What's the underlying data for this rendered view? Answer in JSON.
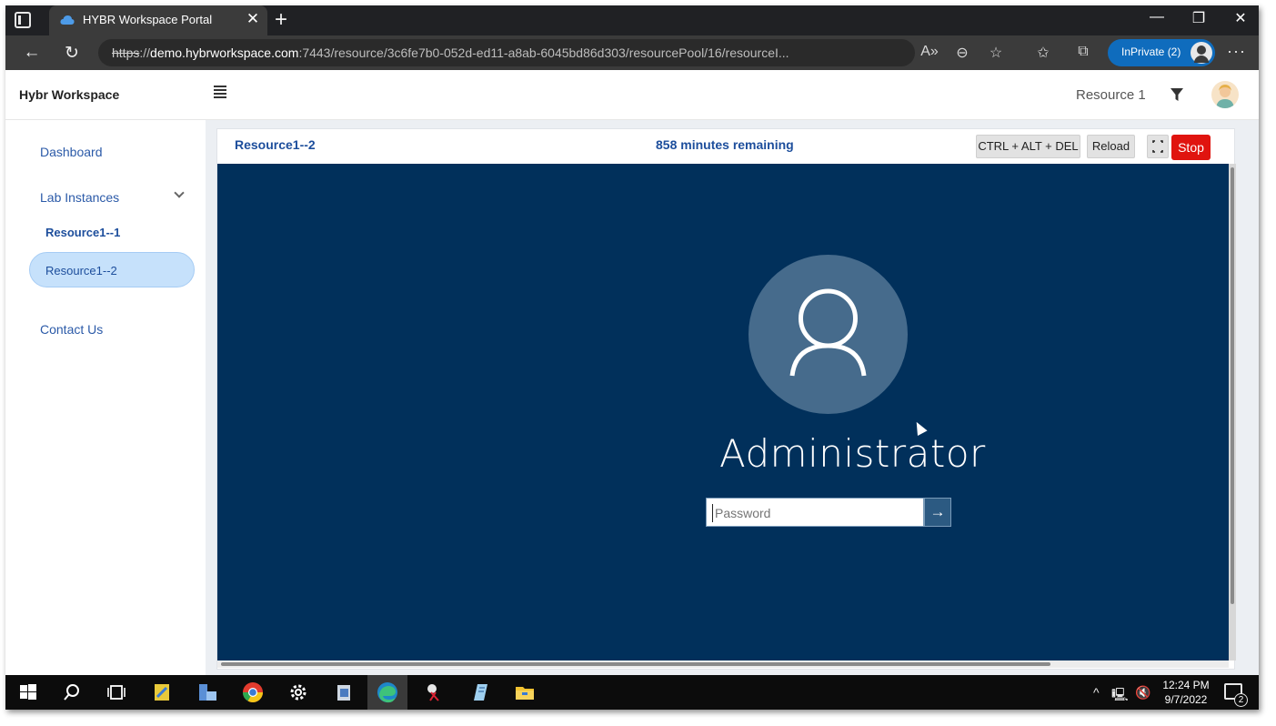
{
  "browser": {
    "tab_title": "HYBR Workspace Portal",
    "tab_close": "✕",
    "new_tab": "+",
    "url_scheme": "https",
    "url_sep": "://",
    "url_host": "demo.hybrworkspace.com",
    "url_rest": ":7443/resource/3c6fe7b0-052d-ed11-a8ab-6045bd86d303/resourcePool/16/resourceI...",
    "inprivate_label": "InPrivate (2)",
    "more": "···",
    "minimize": "—",
    "restore": "❐",
    "close": "✕"
  },
  "header": {
    "brand": "Hybr Workspace",
    "resource_label": "Resource 1"
  },
  "sidebar": {
    "dashboard": "Dashboard",
    "lab_instances": "Lab Instances",
    "resource_1": "Resource1--1",
    "resource_2": "Resource1--2",
    "contact": "Contact Us"
  },
  "resource_panel": {
    "title": "Resource1--2",
    "timer": "858 minutes remaining",
    "ctrl_alt_del": "CTRL + ALT + DEL",
    "reload": "Reload",
    "stop": "Stop"
  },
  "remote_screen": {
    "username": "Administrator",
    "password_placeholder": "Password",
    "submit_glyph": "→"
  },
  "taskbar": {
    "time": "12:24 PM",
    "date": "9/7/2022",
    "notification_count": "2"
  },
  "colors": {
    "remote_background": "#01305b",
    "stop_button": "#e0140f",
    "active_nav": "#c6e1fb",
    "link": "#1d4e9c",
    "inprivate": "#0f6cbd"
  }
}
